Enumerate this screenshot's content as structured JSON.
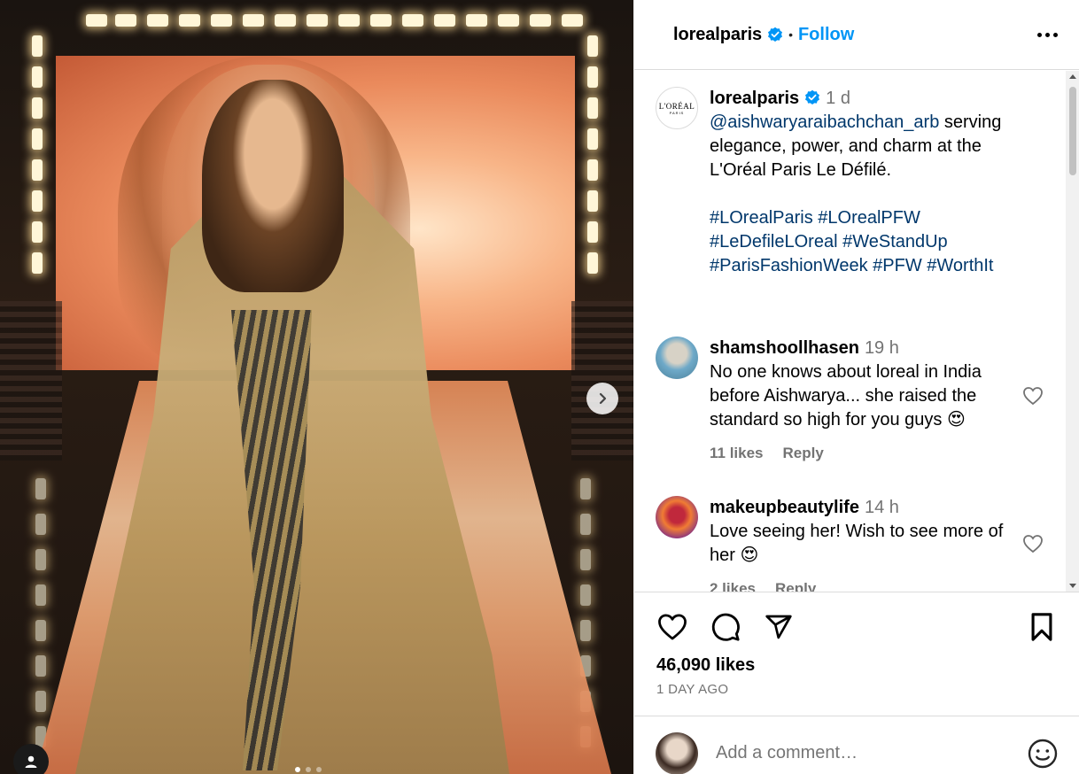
{
  "post": {
    "author": "lorealparis",
    "follow_label": "Follow",
    "separator": "•",
    "avatar_logo_line1": "L'ORÉAL",
    "avatar_logo_line2": "PARIS",
    "caption_time": "1 d",
    "caption_mention": "@aishwaryaraibachchan_arb",
    "caption_text": " serving elegance, power, and charm at the L'Oréal Paris Le Défilé.",
    "hashtags_line1": "#LOrealParis #LOrealPFW",
    "hashtags_line2": "#LeDefileLOreal #WeStandUp",
    "hashtags_line3": "#ParisFashionWeek #PFW #WorthIt",
    "likes": "46,090 likes",
    "date": "1 DAY AGO",
    "comment_placeholder": "Add a comment…"
  },
  "comments": [
    {
      "username": "shamshoollhasen",
      "time": "19 h",
      "text": "No one knows about loreal in India before Aishwarya... she raised the standard so high for you guys 😍",
      "likes": "11 likes",
      "reply_label": "Reply"
    },
    {
      "username": "makeupbeautylife",
      "time": "14 h",
      "text": "Love seeing her! Wish to see more of her 😍",
      "likes": "2 likes",
      "reply_label": "Reply"
    }
  ],
  "colors": {
    "accent": "#0095f6",
    "link": "#00376b",
    "muted": "#737373",
    "verified": "#0095f6"
  },
  "icons": [
    "verified-badge-icon",
    "more-options-icon",
    "heart-icon",
    "comment-icon",
    "share-icon",
    "bookmark-icon",
    "emoji-icon",
    "chevron-right-icon",
    "user-tag-icon"
  ]
}
